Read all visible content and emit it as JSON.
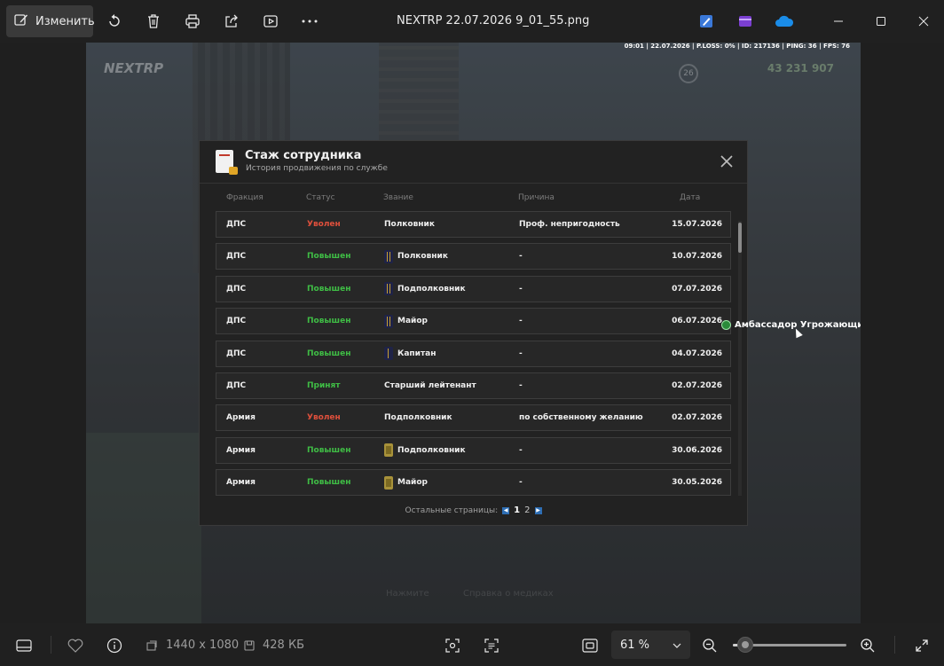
{
  "titlebar": {
    "edit_label": "Изменить",
    "file_name": "NEXTRP 22.07.2026 9_01_55.png",
    "icons": [
      "edit-icon",
      "rotate-icon",
      "delete-icon",
      "print-icon",
      "share-icon",
      "slideshow-icon",
      "more-icon",
      "clipchamp-icon",
      "designer-icon",
      "onedrive-icon",
      "minimize-icon",
      "maximize-icon",
      "close-icon"
    ]
  },
  "game": {
    "stats_line": "09:01 | 22.07.2026 | P.LOSS: 0% | ID: 217136 | PING: 36 | FPS: 76",
    "logo": "NEXTRP",
    "money": "43 231 907",
    "level": "26",
    "hint_left": "Нажмите",
    "hint_right": "Справка о медиках",
    "player_name": "Амбассадор Угрожающий"
  },
  "dialog": {
    "title": "Стаж сотрудника",
    "subtitle": "История продвижения по службе",
    "columns": [
      "Фракция",
      "Статус",
      "Звание",
      "Причина",
      "Дата"
    ],
    "rows": [
      {
        "faction": "ДПС",
        "status": "Уволен",
        "status_color": "#e0503c",
        "rank": "Полковник",
        "badge": "",
        "reason": "Проф. непригодность",
        "date": "15.07.2026"
      },
      {
        "faction": "ДПС",
        "status": "Повышен",
        "status_color": "#3fbd45",
        "rank": "Полковник",
        "badge": "navy",
        "reason": "-",
        "date": "10.07.2026"
      },
      {
        "faction": "ДПС",
        "status": "Повышен",
        "status_color": "#3fbd45",
        "rank": "Подполковник",
        "badge": "navy",
        "reason": "-",
        "date": "07.07.2026"
      },
      {
        "faction": "ДПС",
        "status": "Повышен",
        "status_color": "#3fbd45",
        "rank": "Майор",
        "badge": "navy",
        "reason": "-",
        "date": "06.07.2026"
      },
      {
        "faction": "ДПС",
        "status": "Повышен",
        "status_color": "#3fbd45",
        "rank": "Капитан",
        "badge": "navy one",
        "reason": "-",
        "date": "04.07.2026"
      },
      {
        "faction": "ДПС",
        "status": "Принят",
        "status_color": "#3fbd45",
        "rank": "Старший лейтенант",
        "badge": "",
        "reason": "-",
        "date": "02.07.2026"
      },
      {
        "faction": "Армия",
        "status": "Уволен",
        "status_color": "#e0503c",
        "rank": "Подполковник",
        "badge": "",
        "reason": "по собственному желанию",
        "date": "02.07.2026"
      },
      {
        "faction": "Армия",
        "status": "Повышен",
        "status_color": "#3fbd45",
        "rank": "Подполковник",
        "badge": "olive",
        "reason": "-",
        "date": "30.06.2026"
      },
      {
        "faction": "Армия",
        "status": "Повышен",
        "status_color": "#3fbd45",
        "rank": "Майор",
        "badge": "olive",
        "reason": "-",
        "date": "30.05.2026"
      }
    ],
    "pager_label": "Остальные страницы:",
    "pages": [
      "1",
      "2"
    ],
    "current_page": "1"
  },
  "bottombar": {
    "dimensions": "1440 x 1080",
    "file_size": "428 КБ",
    "zoom": "61 %"
  }
}
